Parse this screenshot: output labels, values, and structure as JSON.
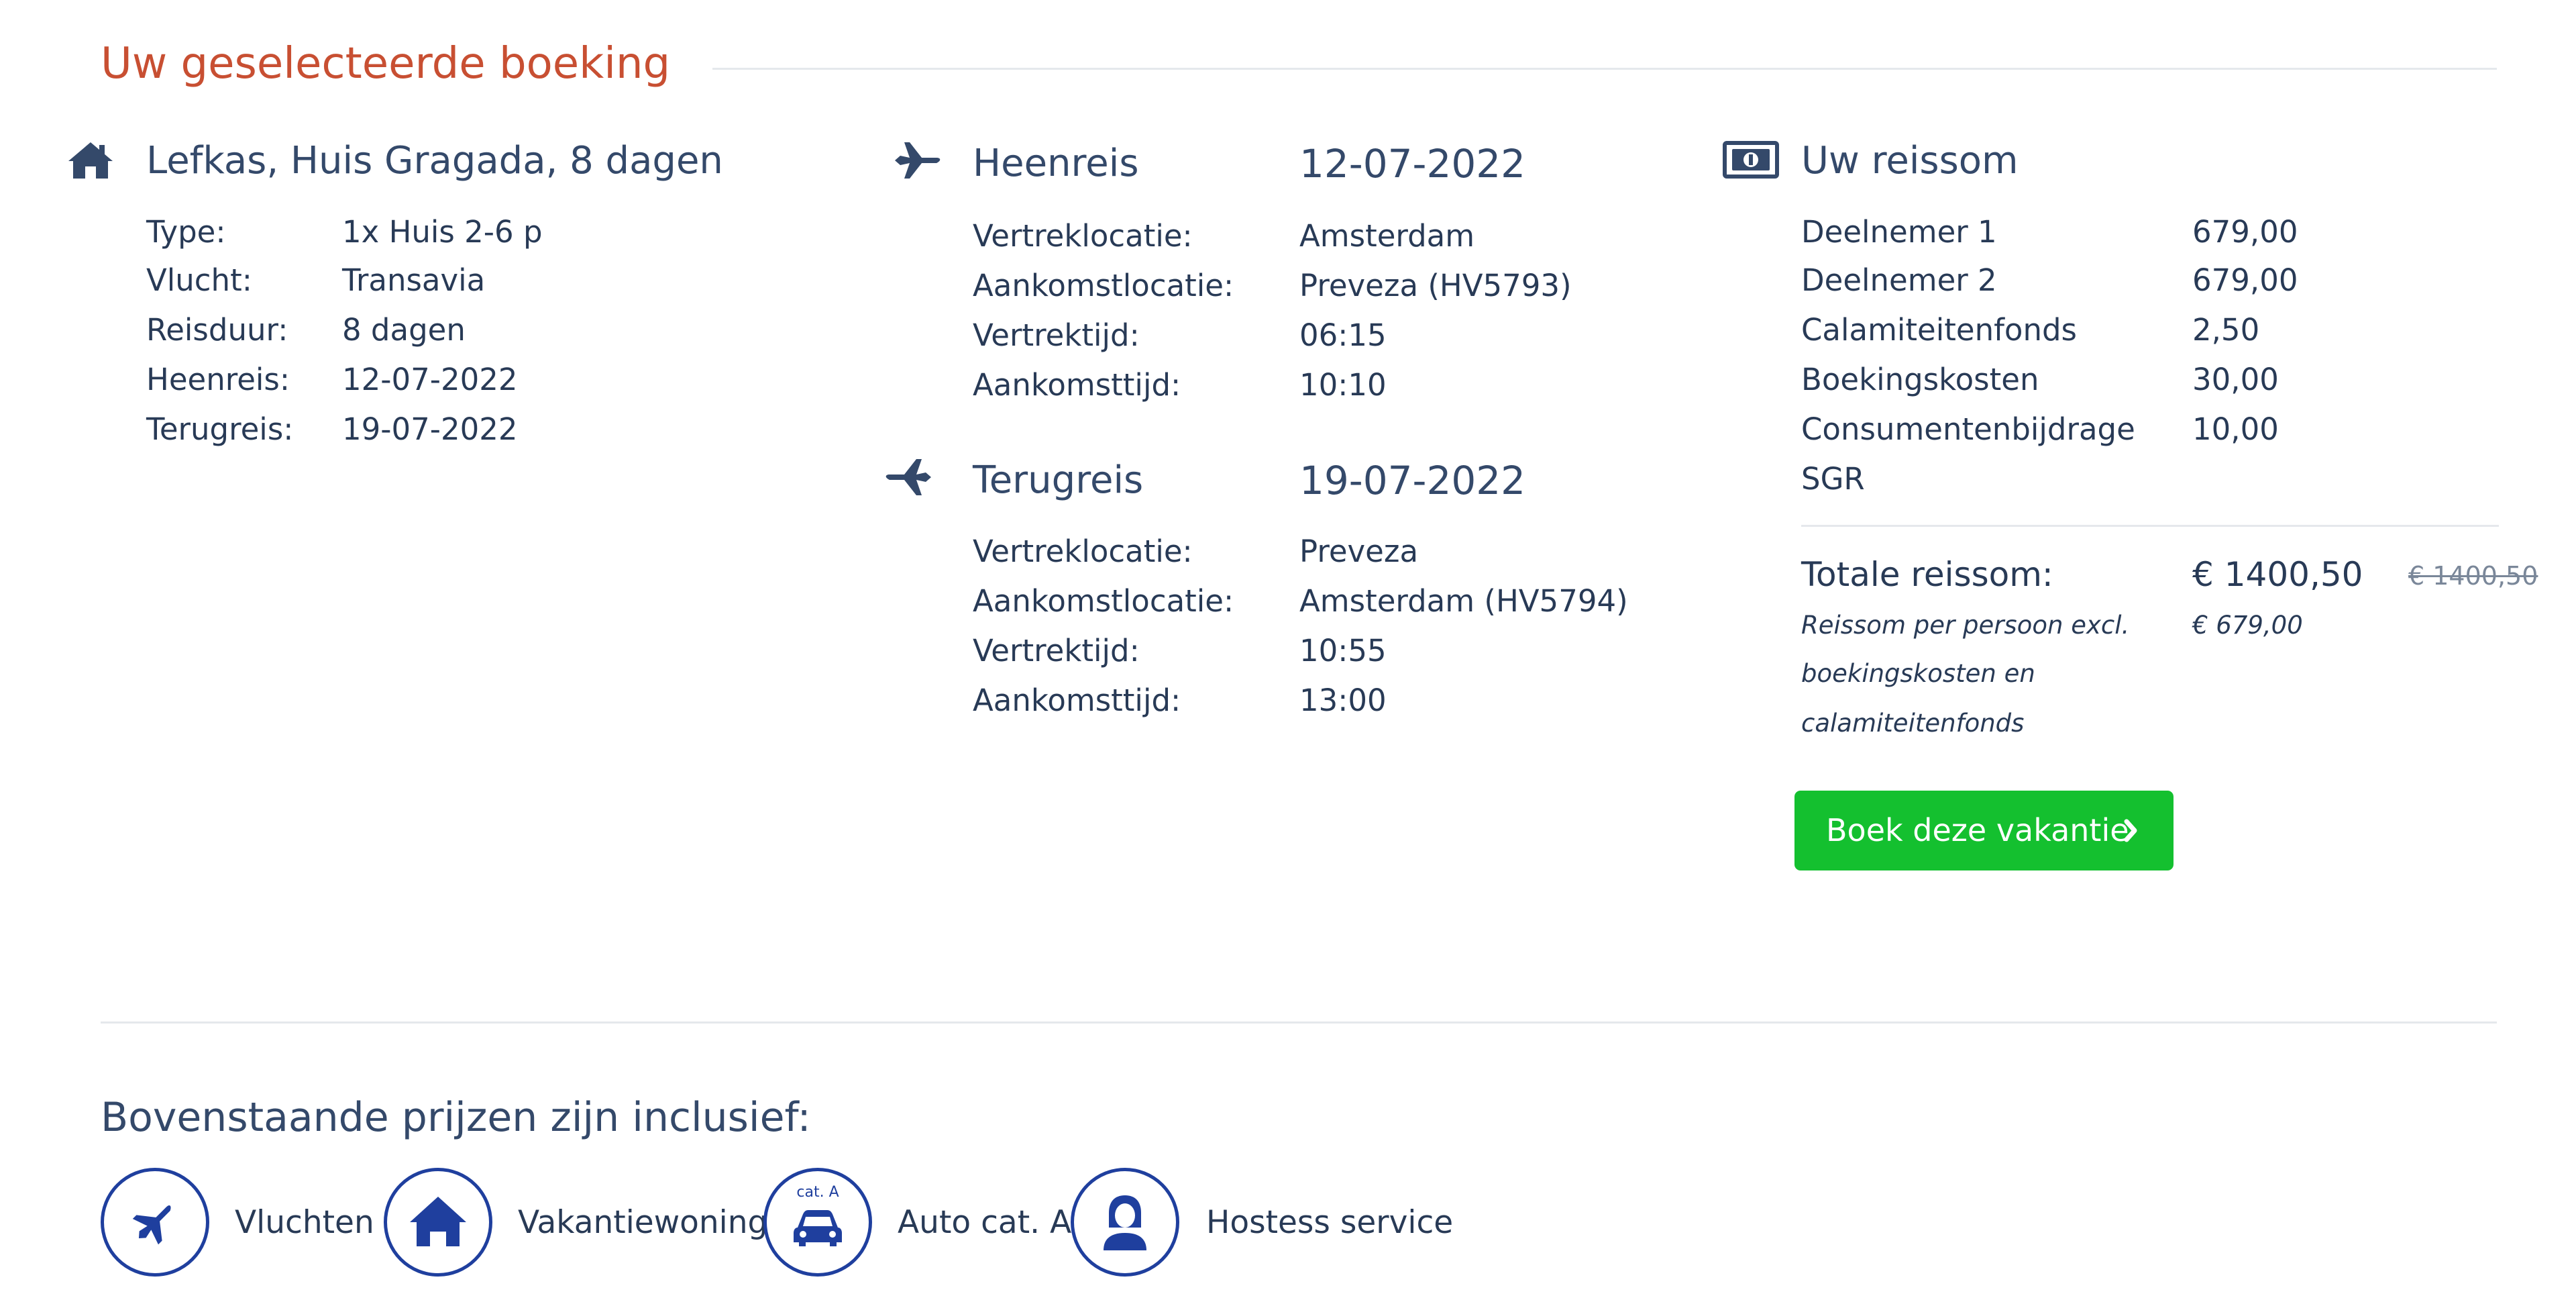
{
  "header": {
    "title": "Uw geselecteerde boeking"
  },
  "accommodation": {
    "title": "Lefkas, Huis Gragada, 8 dagen",
    "rows": [
      {
        "label": "Type:",
        "value": "1x Huis 2-6 p"
      },
      {
        "label": "Vlucht:",
        "value": "Transavia"
      },
      {
        "label": "Reisduur:",
        "value": "8 dagen"
      },
      {
        "label": "Heenreis:",
        "value": "12-07-2022"
      },
      {
        "label": "Terugreis:",
        "value": "19-07-2022"
      }
    ]
  },
  "outbound": {
    "title": "Heenreis",
    "date": "12-07-2022",
    "rows": [
      {
        "label": "Vertreklocatie:",
        "value": "Amsterdam"
      },
      {
        "label": "Aankomstlocatie:",
        "value": "Preveza (HV5793)"
      },
      {
        "label": "Vertrektijd:",
        "value": "06:15"
      },
      {
        "label": "Aankomsttijd:",
        "value": "10:10"
      }
    ]
  },
  "return": {
    "title": "Terugreis",
    "date": "19-07-2022",
    "rows": [
      {
        "label": "Vertreklocatie:",
        "value": "Preveza"
      },
      {
        "label": "Aankomstlocatie:",
        "value": "Amsterdam (HV5794)"
      },
      {
        "label": "Vertrektijd:",
        "value": "10:55"
      },
      {
        "label": "Aankomsttijd:",
        "value": "13:00"
      }
    ]
  },
  "price": {
    "title": "Uw reissom",
    "rows": [
      {
        "label": "Deelnemer 1",
        "value": "679,00"
      },
      {
        "label": "Deelnemer 2",
        "value": "679,00"
      },
      {
        "label": "Calamiteitenfonds",
        "value": "2,50"
      },
      {
        "label": "Boekingskosten",
        "value": "30,00"
      },
      {
        "label": "Consumentenbijdrage",
        "value": "10,00"
      },
      {
        "label": "SGR",
        "value": ""
      }
    ],
    "total_label": "Totale reissom:",
    "total_value": "€ 1400,50",
    "total_old": "€ 1400,50",
    "pp_note_line1": "Reissom per persoon excl.",
    "pp_note_line2": "boekingskosten en",
    "pp_note_line3": "calamiteitenfonds",
    "pp_value": "€ 679,00"
  },
  "book_button": {
    "label": "Boek deze vakantie",
    "icon": "chevron-right-icon"
  },
  "inclusive": {
    "title": "Bovenstaande prijzen zijn inclusief:",
    "items": [
      {
        "icon": "plane-icon",
        "label": "Vluchten"
      },
      {
        "icon": "house-icon",
        "label": "Vakantiewoning"
      },
      {
        "icon": "car-icon",
        "label": "Auto cat. A",
        "badge": "cat. A"
      },
      {
        "icon": "hostess-icon",
        "label": "Hostess service"
      }
    ]
  },
  "colors": {
    "heading_accent": "#c84f32",
    "text": "#283a56",
    "button": "#14c02f",
    "icon_blue": "#1f3f9e"
  }
}
